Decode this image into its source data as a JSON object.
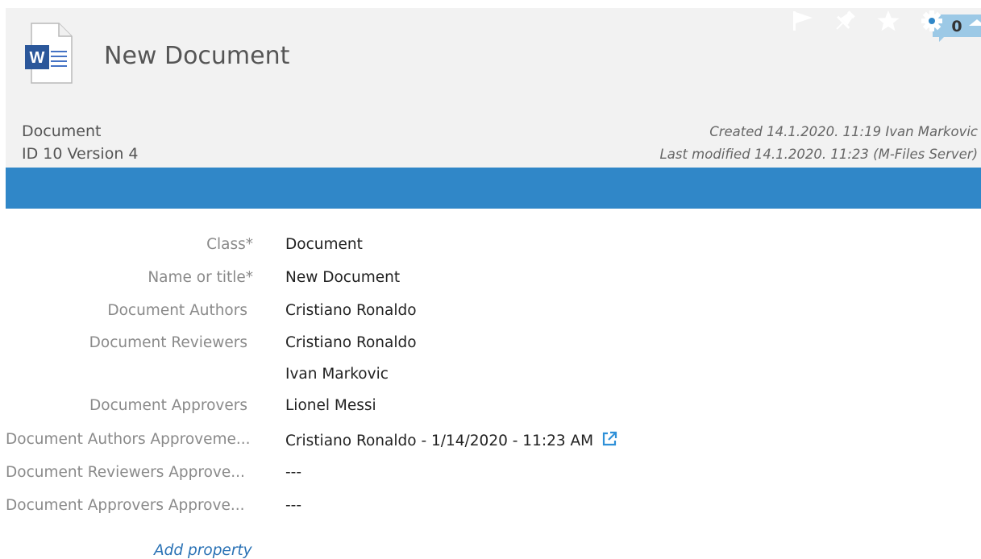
{
  "header": {
    "title": "New Document",
    "doc_icon": "word-document-icon",
    "comment_count": "0",
    "object_type": "Document",
    "id_version": "ID 10  Version 4",
    "created": "Created 14.1.2020. 11:19 Ivan Markovic",
    "modified": "Last modified 14.1.2020. 11:23 (M-Files Server)"
  },
  "toolbar": {
    "color": "#3087c8",
    "icons": [
      "flag-icon",
      "pin-icon",
      "star-icon",
      "gear-icon",
      "collapse-icon"
    ]
  },
  "properties": [
    {
      "label": "Class*",
      "values": [
        "Document"
      ]
    },
    {
      "label": "Name or title*",
      "values": [
        "New Document"
      ]
    },
    {
      "label": "Document Authors",
      "values": [
        "Cristiano Ronaldo"
      ]
    },
    {
      "label": "Document Reviewers",
      "values": [
        "Cristiano Ronaldo",
        "Ivan Markovic"
      ]
    },
    {
      "label": "Document Approvers",
      "values": [
        "Lionel Messi"
      ]
    },
    {
      "label": "Document Authors Approveme...",
      "values": [
        "Cristiano Ronaldo - 1/14/2020 - 11:23 AM"
      ]
    },
    {
      "label": "Document Reviewers Approve...",
      "values": [
        "---"
      ]
    },
    {
      "label": "Document Approvers Approve...",
      "values": [
        "---"
      ]
    }
  ],
  "add_property": "Add property"
}
